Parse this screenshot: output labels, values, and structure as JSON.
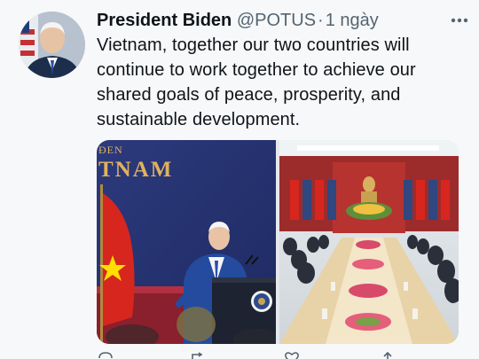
{
  "tweet": {
    "author_name": "President Biden",
    "handle": "@POTUS",
    "separator": "·",
    "time": "1 ngày",
    "text": "Vietnam, together our two countries will continue to work together to achieve our shared goals of peace, prosperity, and sustainable development."
  },
  "media": {
    "photo_left": {
      "backdrop_line1": "ĐEN",
      "backdrop_line2": "TNAM"
    }
  },
  "colors": {
    "text": "#0f1419",
    "secondary": "#536471",
    "background": "#f7f8f9",
    "backdrop_blue": "#2c3a7d",
    "backdrop_gold": "#e0b160",
    "flag_red": "#d7261e",
    "flag_star": "#ffde00"
  },
  "icons": [
    "more-options-icon",
    "reply-icon",
    "retweet-icon",
    "like-icon",
    "share-icon"
  ]
}
